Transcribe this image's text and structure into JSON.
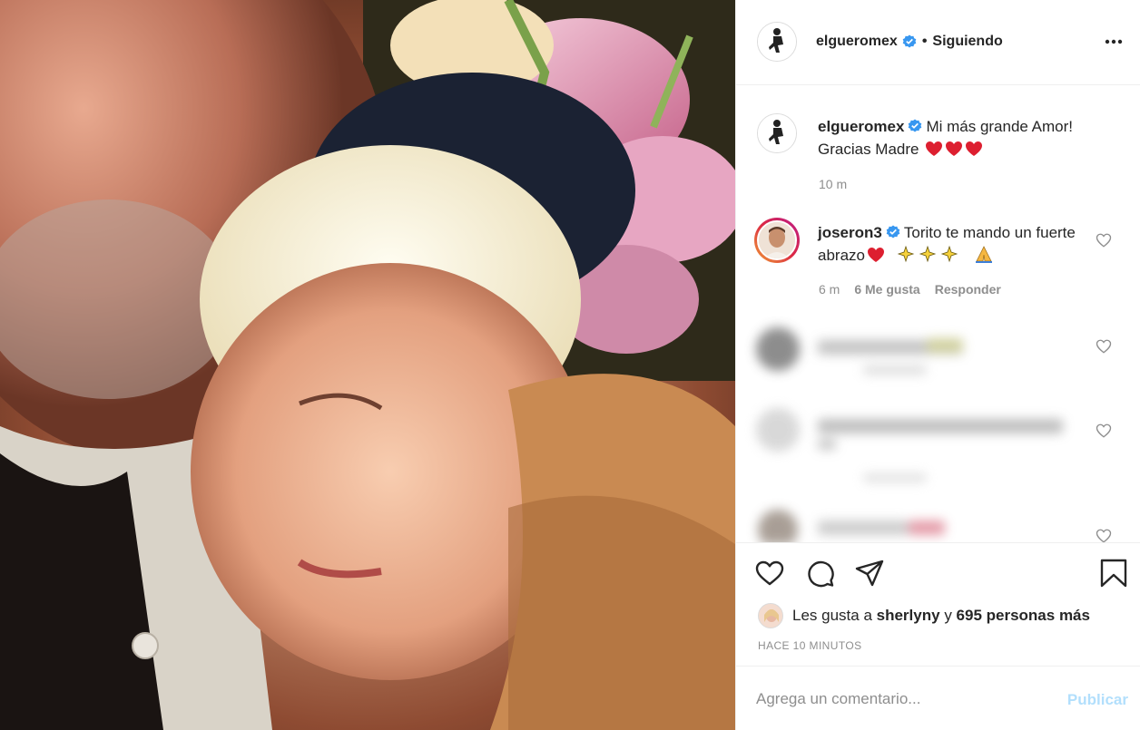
{
  "post": {
    "username": "elgueromex",
    "follow_status": "Siguiendo",
    "separator": "•"
  },
  "caption": {
    "username": "elgueromex",
    "text": "Mi más grande Amor! Gracias Madre",
    "time": "10 m"
  },
  "reply": {
    "username": "joseron3",
    "text_part1": "Torito te mando un fuerte abrazo",
    "time": "6 m",
    "likes": "6 Me gusta",
    "reply_label": "Responder"
  },
  "likes": {
    "prefix": "Les gusta a",
    "user": "sherlyny",
    "connector": "y",
    "others": "695 personas más"
  },
  "timestamp": "HACE 10 MINUTOS",
  "comment_box": {
    "placeholder": "Agrega un comentario...",
    "publish_label": "Publicar"
  },
  "icons": {
    "more": "more-horizontal-icon",
    "like": "heart-outline-icon",
    "comment": "comment-bubble-icon",
    "share": "paper-plane-icon",
    "save": "bookmark-icon",
    "verified": "verified-badge-icon"
  },
  "colors": {
    "verified": "#3897f0",
    "publish": "#b2dffc",
    "muted": "#8e8e8e",
    "heart_emoji": "#dd1f30"
  }
}
